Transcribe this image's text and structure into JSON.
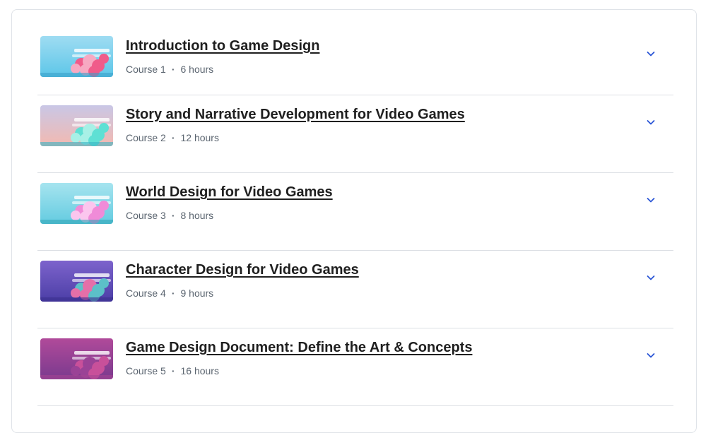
{
  "courses": [
    {
      "title": "Introduction to Game Design",
      "course_label": "Course 1",
      "duration": "6 hours",
      "thumb": {
        "bg1": "#5cc6e8",
        "bg2": "#9fdcf2",
        "accent": "#f05b8a",
        "accent2": "#f7a9c2",
        "ground": "#3aa0c9"
      }
    },
    {
      "title": "Story and Narrative Development for Video Games",
      "course_label": "Course 2",
      "duration": "12 hours",
      "thumb": {
        "bg1": "#f3b9b0",
        "bg2": "#c9c7e6",
        "accent": "#5fe0d4",
        "accent2": "#a8f0e6",
        "ground": "#39b4c4"
      }
    },
    {
      "title": "World Design for Video Games",
      "course_label": "Course 3",
      "duration": "8 hours",
      "thumb": {
        "bg1": "#63cbe0",
        "bg2": "#a6e4ef",
        "accent": "#f08bd8",
        "accent2": "#fbc6ee",
        "ground": "#33a6b8"
      }
    },
    {
      "title": "Character Design for Video Games",
      "course_label": "Course 4",
      "duration": "9 hours",
      "thumb": {
        "bg1": "#4b3ea6",
        "bg2": "#7d63cc",
        "accent": "#5cc0c8",
        "accent2": "#e56fa8",
        "ground": "#3a2f8e"
      }
    },
    {
      "title": "Game Design Document: Define the Art & Concepts",
      "course_label": "Course 5",
      "duration": "16 hours",
      "thumb": {
        "bg1": "#7a3a8e",
        "bg2": "#b04a9a",
        "accent": "#c8509a",
        "accent2": "#9a4296",
        "ground": "#a54592"
      }
    }
  ],
  "colors": {
    "chevron": "#2a56d6"
  },
  "icons": {
    "expand": "chevron-down-icon"
  }
}
